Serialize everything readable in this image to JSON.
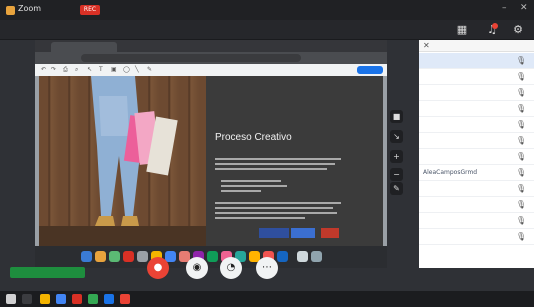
{
  "app": {
    "title": "Zoom",
    "rec_label": "REC",
    "minimize": "–",
    "close": "✕"
  },
  "subbar": {
    "left_text": "",
    "center_text": "",
    "icons": [
      "layout-icon",
      "bell-icon",
      "settings-icon"
    ]
  },
  "slide": {
    "title": "Proceso Creativo"
  },
  "browser": {
    "tabs": [
      "",
      "",
      ""
    ],
    "url": ""
  },
  "slides_toolbar": {
    "share_label": ""
  },
  "participants_panel": {
    "title": "",
    "tab2": "",
    "close_glyph": "✕",
    "rows": [
      {
        "name": "",
        "selected": true
      },
      {
        "name": ""
      },
      {
        "name": ""
      },
      {
        "name": ""
      },
      {
        "name": ""
      },
      {
        "name": ""
      },
      {
        "name": ""
      },
      {
        "name": "AleaCamposGrmd"
      },
      {
        "name": ""
      },
      {
        "name": ""
      },
      {
        "name": ""
      },
      {
        "name": ""
      }
    ],
    "footer_text": "",
    "action_label": ""
  },
  "controls": {
    "badge": "",
    "buttons": [
      {
        "glyph": "●",
        "label": "",
        "icon": "stop-icon"
      },
      {
        "glyph": "◉",
        "label": "",
        "icon": "camera-icon"
      },
      {
        "glyph": "◔",
        "label": "",
        "icon": "share-screen-icon"
      },
      {
        "glyph": "⋯",
        "label": "",
        "icon": "more-icon"
      }
    ]
  },
  "taskbar": {
    "time": "",
    "date": ""
  },
  "colors": {
    "accent": "#1a73e8",
    "record_red": "#ea4335",
    "badge_green": "#1e8e3e"
  }
}
